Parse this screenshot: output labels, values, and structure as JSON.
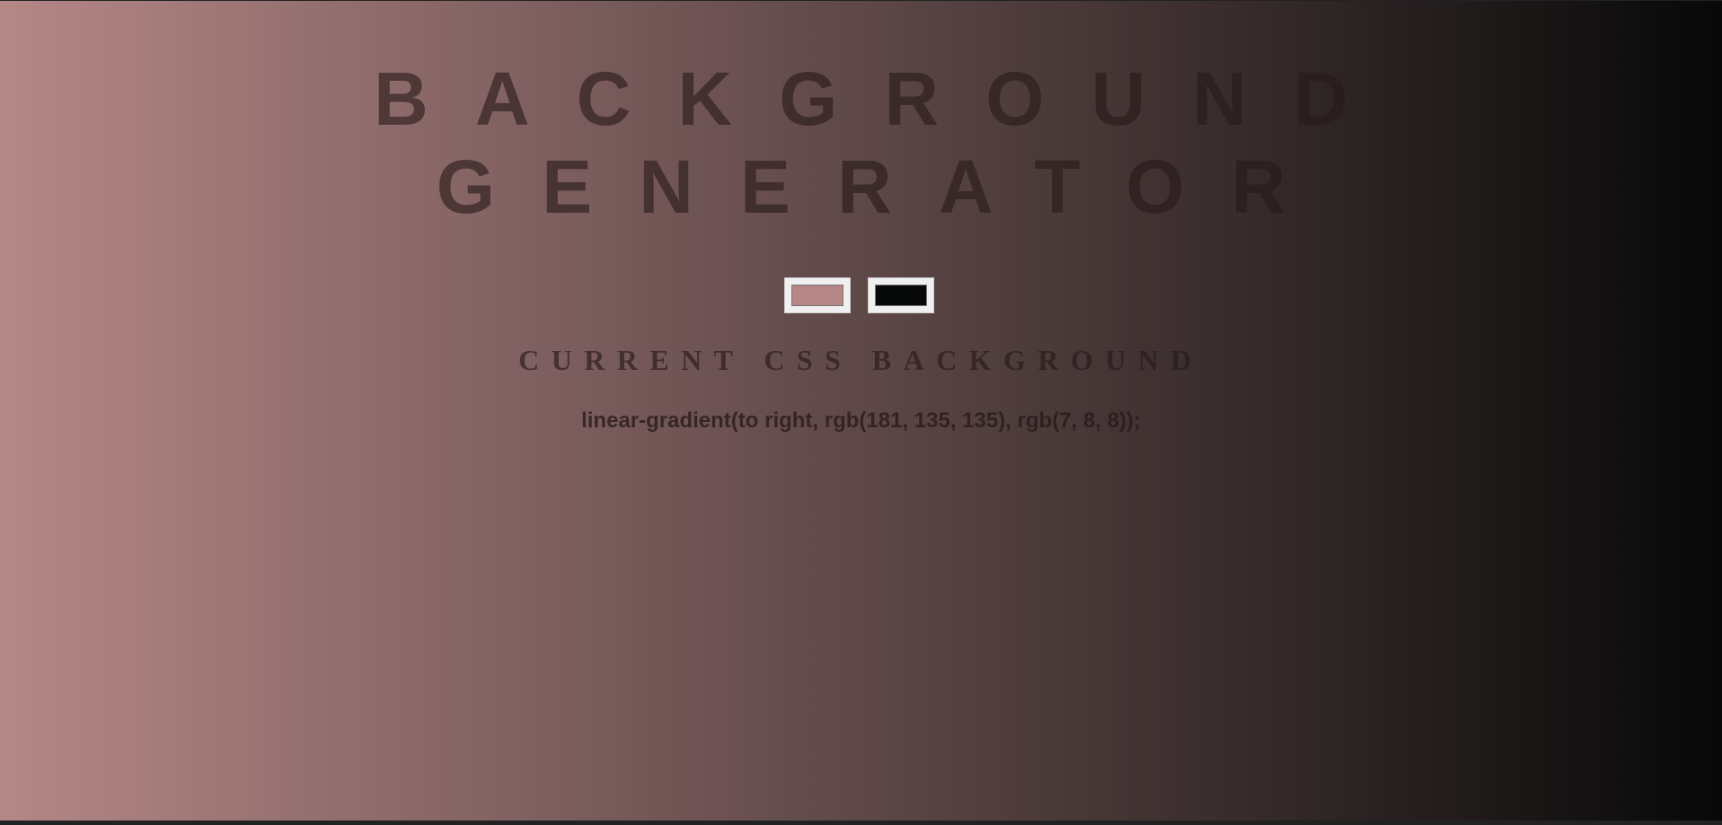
{
  "page": {
    "title_line1": "BACKGROUND",
    "title_line2": "GENERATOR",
    "subtitle": "CURRENT CSS BACKGROUND",
    "css_output": "linear-gradient(to right, rgb(181, 135, 135), rgb(7, 8, 8));"
  },
  "inputs": {
    "color1": "#b58787",
    "color2": "#070808"
  },
  "colors": {
    "gradient_start": "#b58787",
    "gradient_end": "#070808",
    "text": "#3a2a2a"
  }
}
